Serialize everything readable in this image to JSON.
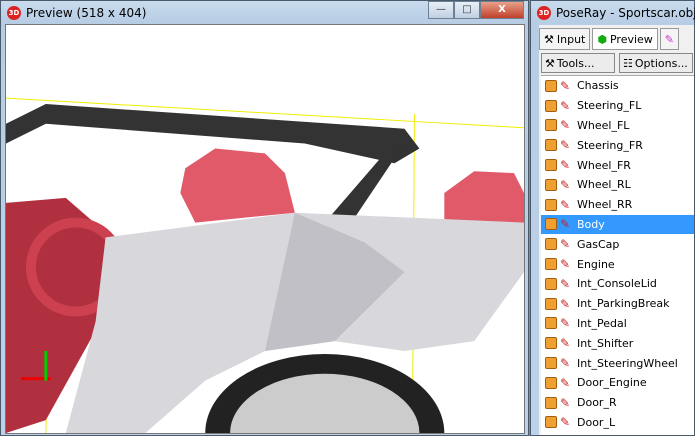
{
  "preview": {
    "title": "Preview (518 x 404)",
    "logo": "3D",
    "controls": {
      "minimize": "—",
      "maximize": "□",
      "close": "X"
    }
  },
  "poseray": {
    "title": "PoseRay - Sportscar.obj",
    "logo": "3D",
    "tabs": [
      {
        "label": "Input",
        "icon": "wrench-icon"
      },
      {
        "label": "Preview",
        "icon": "gem-icon"
      },
      {
        "label": "",
        "icon": "paint-icon"
      }
    ],
    "buttons": {
      "tools": "Tools...",
      "options": "Options..."
    },
    "groups": [
      "Chassis",
      "Steering_FL",
      "Wheel_FL",
      "Steering_FR",
      "Wheel_FR",
      "Wheel_RL",
      "Wheel_RR",
      "Body",
      "GasCap",
      "Engine",
      "Int_ConsoleLid",
      "Int_ParkingBreak",
      "Int_Pedal",
      "Int_Shifter",
      "Int_SteeringWheel",
      "Door_Engine",
      "Door_R",
      "Door_L"
    ],
    "selected": "Body"
  }
}
